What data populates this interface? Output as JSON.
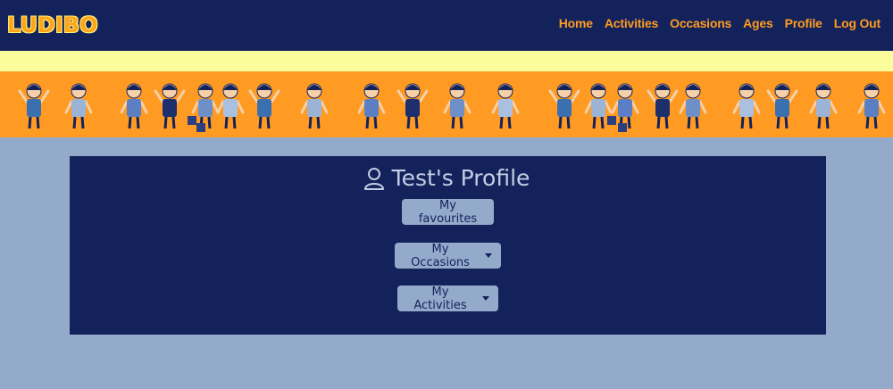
{
  "nav": {
    "logo": "LUDIBO",
    "links": [
      "Home",
      "Activities",
      "Occasions",
      "Ages",
      "Profile",
      "Log Out"
    ]
  },
  "profile": {
    "title": "Test's Profile",
    "favourites_label": "My favourites",
    "occasions_label": "My Occasions",
    "activities_label": "My Activities"
  },
  "colors": {
    "navy": "#14225c",
    "page_bg": "#94aacb",
    "banner_orange": "#ff9b22",
    "strip_yellow": "#fbfc9b",
    "nav_orange": "#ff9c1f"
  },
  "icons": {
    "profile": "user-icon",
    "dropdown": "caret-down-icon"
  }
}
